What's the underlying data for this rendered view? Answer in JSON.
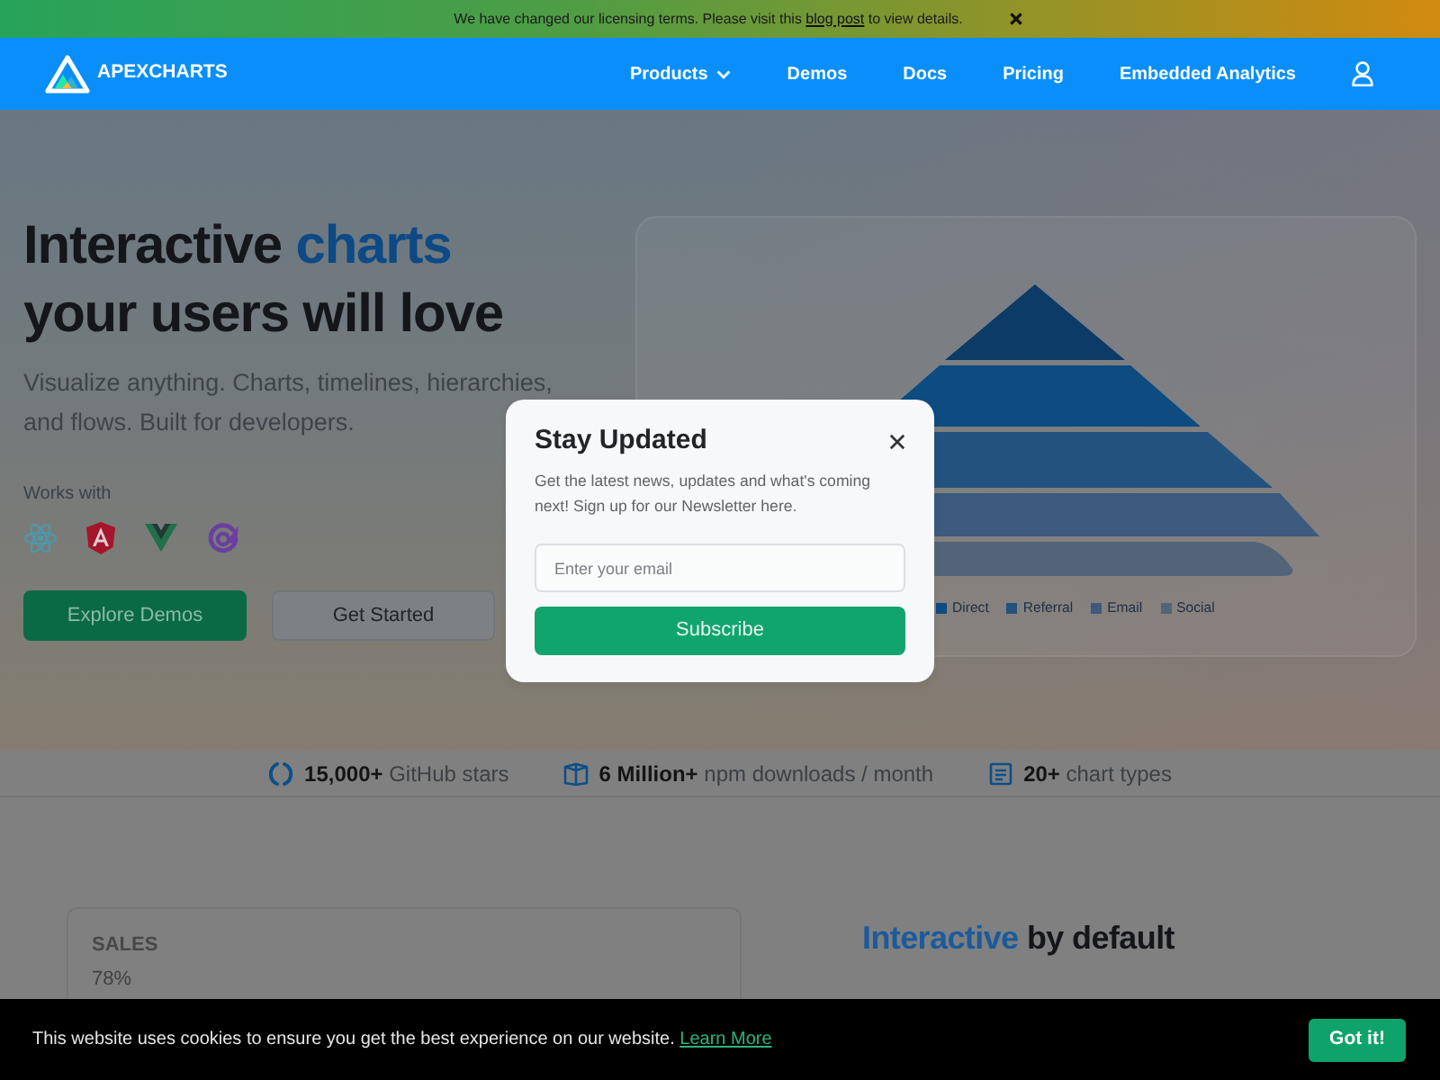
{
  "banner": {
    "before": "We have changed our licensing terms. Please visit this",
    "link": "blog post",
    "after": "to view details."
  },
  "navbar": {
    "brand": "APEXCHARTS",
    "items": [
      {
        "label": "Products",
        "dropdown": true
      },
      {
        "label": "Demos",
        "dropdown": false
      },
      {
        "label": "Docs",
        "dropdown": false
      },
      {
        "label": "Pricing",
        "dropdown": false
      },
      {
        "label": "Embedded Analytics",
        "dropdown": false
      }
    ]
  },
  "hero": {
    "heading": [
      {
        "text": "Interactive",
        "highlight": false
      },
      {
        "text": "charts",
        "highlight": true
      },
      {
        "text": "your users will love",
        "highlight": false
      }
    ],
    "subtitle": "Visualize anything. Charts, timelines, hierarchies, and flows. Built for developers.",
    "works_with": "Works with",
    "buttons": [
      {
        "label": "Explore Demos",
        "kind": "primary"
      },
      {
        "label": "Get Started",
        "kind": "secondary"
      }
    ],
    "chart": {
      "layers": [
        {
          "color": "#0b3b66"
        },
        {
          "color": "#0d4b80"
        },
        {
          "color": "#24527e"
        },
        {
          "color": "#3b5a7e"
        },
        {
          "color": "#536479"
        }
      ],
      "legend": [
        {
          "label": "Direct",
          "color": "#0d4b80"
        },
        {
          "label": "Referral",
          "color": "#24527e"
        },
        {
          "label": "Email",
          "color": "#3b5a7e"
        },
        {
          "label": "Social",
          "color": "#536479"
        }
      ]
    }
  },
  "stats": [
    "**15,000+** GitHub stars",
    "**6 Million+** npm downloads / month",
    "**20+** chart types"
  ],
  "features": {
    "card": {
      "title": "SALES",
      "value": "78%"
    },
    "heading": [
      {
        "text": "Interactive",
        "highlight": true
      },
      {
        "text": "by default",
        "highlight": false
      }
    ]
  },
  "modal": {
    "title": "Stay Updated",
    "text": "Get the latest news, updates and what's coming next! Sign up for our Newsletter here.",
    "input": {
      "placeholder": "Enter your email"
    },
    "button": "Subscribe"
  },
  "cookie_bar": {
    "text": "This website uses cookies to ensure you get the best experience on our website.",
    "link": "Learn More",
    "button": "Got it!"
  }
}
